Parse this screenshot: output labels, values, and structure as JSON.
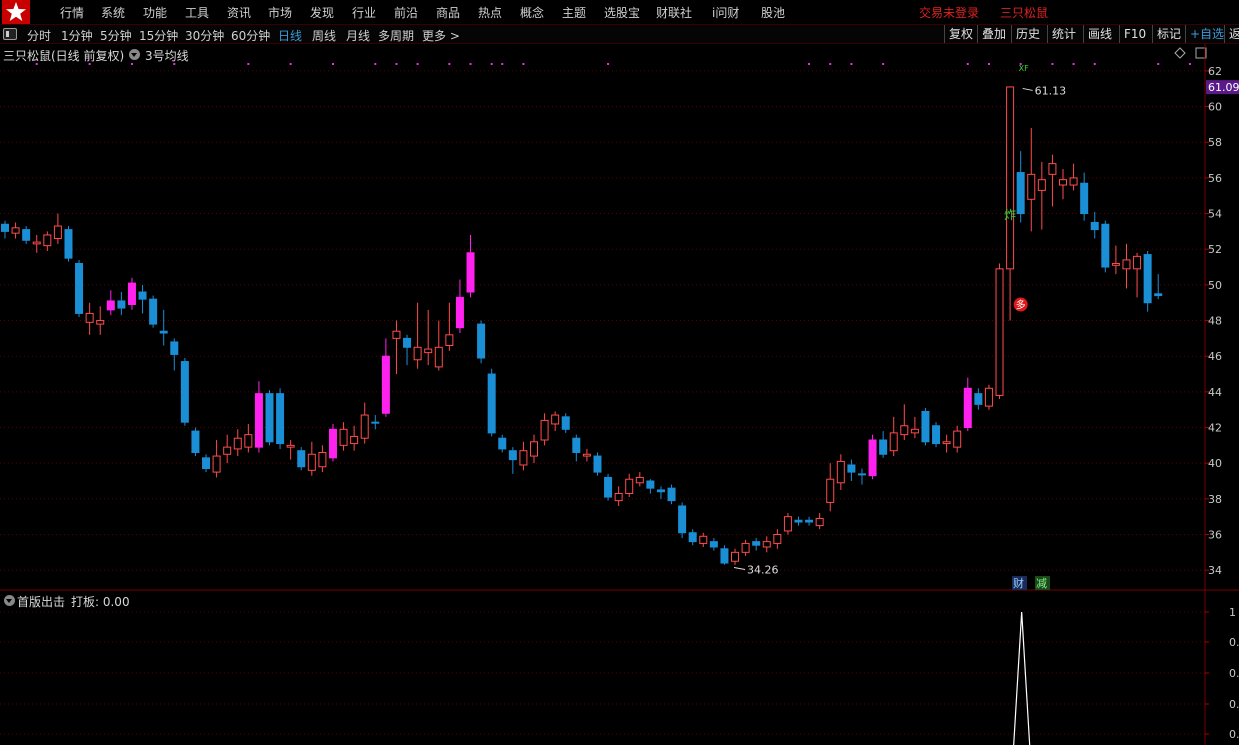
{
  "menu": {
    "items": [
      "行情",
      "系统",
      "功能",
      "工具",
      "资讯",
      "市场",
      "发现",
      "行业",
      "前沿",
      "商品",
      "热点",
      "概念",
      "主题",
      "选股宝",
      "财联社",
      "i问财",
      "股池"
    ],
    "login_status": "交易未登录",
    "stock_name": "三只松鼠"
  },
  "toolbar": {
    "periods": [
      "分时",
      "1分钟",
      "5分钟",
      "15分钟",
      "30分钟",
      "60分钟",
      "日线",
      "周线",
      "月线",
      "多周期",
      "更多 >"
    ],
    "active_period": "日线",
    "right_buttons": [
      "复权",
      "叠加",
      "历史",
      "统计",
      "画线",
      "F10",
      "标记",
      "+自选",
      "返"
    ]
  },
  "chart_header": {
    "title": "三只松鼠(日线 前复权)",
    "ma_label": "3号均线"
  },
  "indicator": {
    "name": "首版出击",
    "value_label": "打板: 0.00"
  },
  "colors": {
    "up": "#ff4c4c",
    "down": "#1a8fd6",
    "special": "#ff22ee",
    "grid": "#5a0000",
    "axis_text": "#c8c8c8",
    "price_tag_bg": "#5a1a8a"
  },
  "chart_data": {
    "type": "candlestick",
    "ylim": [
      33,
      62.5
    ],
    "y_ticks": [
      34,
      36,
      38,
      40,
      42,
      44,
      46,
      48,
      50,
      52,
      54,
      56,
      58,
      60,
      62
    ],
    "current_price": "61.09",
    "annotations": {
      "high": "61.13",
      "low": "34.26"
    },
    "signal_labels": {
      "zha": "炸",
      "duo": "多",
      "cai": "财",
      "jian": "减",
      "top": "XF"
    },
    "candles": [
      {
        "o": 53.0,
        "c": 53.4,
        "h": 53.6,
        "l": 52.6,
        "k": "d"
      },
      {
        "o": 52.9,
        "c": 53.2,
        "h": 53.5,
        "l": 52.6,
        "k": "u"
      },
      {
        "o": 53.1,
        "c": 52.5,
        "h": 53.3,
        "l": 52.3,
        "k": "d"
      },
      {
        "o": 52.3,
        "c": 52.4,
        "h": 52.8,
        "l": 51.8,
        "k": "u"
      },
      {
        "o": 52.2,
        "c": 52.8,
        "h": 53.0,
        "l": 51.9,
        "k": "u"
      },
      {
        "o": 52.6,
        "c": 53.3,
        "h": 54.0,
        "l": 52.3,
        "k": "u"
      },
      {
        "o": 53.1,
        "c": 51.5,
        "h": 53.3,
        "l": 51.3,
        "k": "d"
      },
      {
        "o": 51.2,
        "c": 48.4,
        "h": 51.4,
        "l": 48.2,
        "k": "d"
      },
      {
        "o": 47.9,
        "c": 48.4,
        "h": 49.0,
        "l": 47.2,
        "k": "u"
      },
      {
        "o": 48.0,
        "c": 47.8,
        "h": 48.8,
        "l": 47.2,
        "k": "u"
      },
      {
        "o": 48.6,
        "c": 49.1,
        "h": 49.7,
        "l": 48.3,
        "k": "s"
      },
      {
        "o": 49.1,
        "c": 48.7,
        "h": 49.6,
        "l": 48.3,
        "k": "d"
      },
      {
        "o": 48.9,
        "c": 50.1,
        "h": 50.4,
        "l": 48.6,
        "k": "s"
      },
      {
        "o": 49.6,
        "c": 49.2,
        "h": 50.0,
        "l": 48.4,
        "k": "d"
      },
      {
        "o": 49.2,
        "c": 47.8,
        "h": 49.4,
        "l": 47.6,
        "k": "d"
      },
      {
        "o": 47.4,
        "c": 47.3,
        "h": 48.6,
        "l": 46.6,
        "k": "d"
      },
      {
        "o": 46.8,
        "c": 46.1,
        "h": 47.0,
        "l": 45.2,
        "k": "d"
      },
      {
        "o": 45.7,
        "c": 42.3,
        "h": 45.9,
        "l": 42.1,
        "k": "d"
      },
      {
        "o": 41.8,
        "c": 40.6,
        "h": 42.0,
        "l": 40.4,
        "k": "d"
      },
      {
        "o": 40.3,
        "c": 39.7,
        "h": 40.5,
        "l": 39.5,
        "k": "d"
      },
      {
        "o": 39.5,
        "c": 40.4,
        "h": 41.3,
        "l": 39.2,
        "k": "u"
      },
      {
        "o": 40.5,
        "c": 40.9,
        "h": 41.6,
        "l": 40.0,
        "k": "u"
      },
      {
        "o": 40.8,
        "c": 41.4,
        "h": 41.9,
        "l": 40.4,
        "k": "u"
      },
      {
        "o": 40.9,
        "c": 41.6,
        "h": 42.2,
        "l": 40.6,
        "k": "u"
      },
      {
        "o": 40.9,
        "c": 43.9,
        "h": 44.6,
        "l": 40.6,
        "k": "s"
      },
      {
        "o": 43.9,
        "c": 41.2,
        "h": 44.1,
        "l": 41.0,
        "k": "d"
      },
      {
        "o": 43.9,
        "c": 41.1,
        "h": 44.2,
        "l": 40.8,
        "k": "d"
      },
      {
        "o": 40.9,
        "c": 41.0,
        "h": 41.3,
        "l": 40.2,
        "k": "u"
      },
      {
        "o": 40.7,
        "c": 39.8,
        "h": 40.9,
        "l": 39.6,
        "k": "d"
      },
      {
        "o": 39.6,
        "c": 40.5,
        "h": 41.2,
        "l": 39.3,
        "k": "u"
      },
      {
        "o": 39.8,
        "c": 40.6,
        "h": 41.0,
        "l": 39.5,
        "k": "u"
      },
      {
        "o": 40.3,
        "c": 41.9,
        "h": 42.2,
        "l": 40.1,
        "k": "s"
      },
      {
        "o": 41.0,
        "c": 41.9,
        "h": 42.3,
        "l": 40.7,
        "k": "u"
      },
      {
        "o": 41.5,
        "c": 41.1,
        "h": 42.1,
        "l": 40.7,
        "k": "u"
      },
      {
        "o": 41.4,
        "c": 42.7,
        "h": 43.4,
        "l": 41.1,
        "k": "u"
      },
      {
        "o": 42.3,
        "c": 42.3,
        "h": 42.7,
        "l": 41.9,
        "k": "d"
      },
      {
        "o": 42.8,
        "c": 46.0,
        "h": 47.0,
        "l": 42.6,
        "k": "s"
      },
      {
        "o": 47.0,
        "c": 47.4,
        "h": 48.0,
        "l": 45.0,
        "k": "u"
      },
      {
        "o": 47.0,
        "c": 46.5,
        "h": 47.2,
        "l": 45.5,
        "k": "d"
      },
      {
        "o": 45.8,
        "c": 46.5,
        "h": 49.0,
        "l": 45.3,
        "k": "u"
      },
      {
        "o": 46.2,
        "c": 46.4,
        "h": 48.6,
        "l": 45.5,
        "k": "u"
      },
      {
        "o": 45.4,
        "c": 46.5,
        "h": 48.0,
        "l": 45.2,
        "k": "u"
      },
      {
        "o": 46.6,
        "c": 47.2,
        "h": 49.0,
        "l": 46.3,
        "k": "u"
      },
      {
        "o": 47.6,
        "c": 49.3,
        "h": 50.3,
        "l": 47.3,
        "k": "s"
      },
      {
        "o": 49.6,
        "c": 51.8,
        "h": 52.8,
        "l": 49.3,
        "k": "s"
      },
      {
        "o": 47.8,
        "c": 45.9,
        "h": 48.0,
        "l": 45.6,
        "k": "d"
      },
      {
        "o": 45.0,
        "c": 41.7,
        "h": 45.3,
        "l": 41.5,
        "k": "d"
      },
      {
        "o": 41.4,
        "c": 40.8,
        "h": 41.6,
        "l": 40.6,
        "k": "d"
      },
      {
        "o": 40.7,
        "c": 40.2,
        "h": 40.9,
        "l": 39.4,
        "k": "d"
      },
      {
        "o": 39.9,
        "c": 40.7,
        "h": 41.2,
        "l": 39.6,
        "k": "u"
      },
      {
        "o": 40.4,
        "c": 41.2,
        "h": 41.6,
        "l": 40.0,
        "k": "u"
      },
      {
        "o": 41.3,
        "c": 42.4,
        "h": 42.8,
        "l": 41.0,
        "k": "u"
      },
      {
        "o": 42.2,
        "c": 42.7,
        "h": 42.9,
        "l": 41.8,
        "k": "u"
      },
      {
        "o": 42.6,
        "c": 41.9,
        "h": 42.8,
        "l": 41.7,
        "k": "d"
      },
      {
        "o": 41.4,
        "c": 40.6,
        "h": 41.6,
        "l": 40.1,
        "k": "d"
      },
      {
        "o": 40.4,
        "c": 40.5,
        "h": 40.8,
        "l": 40.1,
        "k": "u"
      },
      {
        "o": 40.4,
        "c": 39.5,
        "h": 40.6,
        "l": 39.3,
        "k": "d"
      },
      {
        "o": 39.2,
        "c": 38.1,
        "h": 39.4,
        "l": 37.9,
        "k": "d"
      },
      {
        "o": 37.9,
        "c": 38.3,
        "h": 38.7,
        "l": 37.6,
        "k": "u"
      },
      {
        "o": 38.3,
        "c": 39.1,
        "h": 39.4,
        "l": 38.1,
        "k": "u"
      },
      {
        "o": 38.9,
        "c": 39.2,
        "h": 39.5,
        "l": 38.7,
        "k": "u"
      },
      {
        "o": 39.0,
        "c": 38.6,
        "h": 39.1,
        "l": 38.3,
        "k": "d"
      },
      {
        "o": 38.5,
        "c": 38.4,
        "h": 38.7,
        "l": 38.0,
        "k": "d"
      },
      {
        "o": 38.6,
        "c": 37.9,
        "h": 38.8,
        "l": 37.7,
        "k": "d"
      },
      {
        "o": 37.6,
        "c": 36.1,
        "h": 37.8,
        "l": 35.8,
        "k": "d"
      },
      {
        "o": 36.1,
        "c": 35.6,
        "h": 36.3,
        "l": 35.4,
        "k": "d"
      },
      {
        "o": 35.5,
        "c": 35.9,
        "h": 36.1,
        "l": 35.3,
        "k": "u"
      },
      {
        "o": 35.6,
        "c": 35.3,
        "h": 35.8,
        "l": 35.1,
        "k": "d"
      },
      {
        "o": 35.2,
        "c": 34.4,
        "h": 35.4,
        "l": 34.3,
        "k": "d"
      },
      {
        "o": 34.5,
        "c": 35.0,
        "h": 35.2,
        "l": 34.3,
        "k": "u"
      },
      {
        "o": 35.0,
        "c": 35.5,
        "h": 35.7,
        "l": 34.8,
        "k": "u"
      },
      {
        "o": 35.6,
        "c": 35.4,
        "h": 35.8,
        "l": 35.1,
        "k": "d"
      },
      {
        "o": 35.3,
        "c": 35.6,
        "h": 35.9,
        "l": 35.0,
        "k": "u"
      },
      {
        "o": 35.5,
        "c": 36.0,
        "h": 36.3,
        "l": 35.2,
        "k": "u"
      },
      {
        "o": 36.2,
        "c": 37.0,
        "h": 37.2,
        "l": 36.0,
        "k": "u"
      },
      {
        "o": 36.8,
        "c": 36.7,
        "h": 37.0,
        "l": 36.5,
        "k": "d"
      },
      {
        "o": 36.7,
        "c": 36.8,
        "h": 37.0,
        "l": 36.5,
        "k": "d"
      },
      {
        "o": 36.5,
        "c": 36.9,
        "h": 37.2,
        "l": 36.3,
        "k": "u"
      },
      {
        "o": 37.8,
        "c": 39.1,
        "h": 40.0,
        "l": 37.3,
        "k": "u"
      },
      {
        "o": 38.9,
        "c": 40.1,
        "h": 40.5,
        "l": 38.5,
        "k": "u"
      },
      {
        "o": 39.9,
        "c": 39.5,
        "h": 40.2,
        "l": 39.0,
        "k": "d"
      },
      {
        "o": 39.4,
        "c": 39.4,
        "h": 39.7,
        "l": 38.8,
        "k": "d"
      },
      {
        "o": 39.3,
        "c": 41.3,
        "h": 41.6,
        "l": 39.1,
        "k": "s"
      },
      {
        "o": 41.3,
        "c": 40.5,
        "h": 41.8,
        "l": 40.3,
        "k": "d"
      },
      {
        "o": 40.7,
        "c": 41.7,
        "h": 42.6,
        "l": 40.4,
        "k": "u"
      },
      {
        "o": 41.6,
        "c": 42.1,
        "h": 43.3,
        "l": 41.3,
        "k": "u"
      },
      {
        "o": 41.9,
        "c": 41.7,
        "h": 42.6,
        "l": 41.4,
        "k": "u"
      },
      {
        "o": 42.9,
        "c": 41.2,
        "h": 43.1,
        "l": 41.0,
        "k": "d"
      },
      {
        "o": 42.1,
        "c": 41.1,
        "h": 42.3,
        "l": 40.9,
        "k": "d"
      },
      {
        "o": 41.1,
        "c": 41.2,
        "h": 41.6,
        "l": 40.6,
        "k": "u"
      },
      {
        "o": 40.9,
        "c": 41.8,
        "h": 42.1,
        "l": 40.6,
        "k": "u"
      },
      {
        "o": 42.0,
        "c": 44.2,
        "h": 44.8,
        "l": 41.8,
        "k": "s"
      },
      {
        "o": 43.9,
        "c": 43.3,
        "h": 44.2,
        "l": 43.0,
        "k": "d"
      },
      {
        "o": 43.2,
        "c": 44.2,
        "h": 44.4,
        "l": 43.0,
        "k": "u"
      },
      {
        "o": 43.8,
        "c": 50.9,
        "h": 51.2,
        "l": 43.6,
        "k": "u"
      },
      {
        "o": 50.9,
        "c": 61.1,
        "h": 61.13,
        "l": 48.0,
        "k": "u"
      },
      {
        "o": 56.3,
        "c": 54.0,
        "h": 57.5,
        "l": 53.5,
        "k": "d"
      },
      {
        "o": 54.8,
        "c": 56.2,
        "h": 58.8,
        "l": 53.0,
        "k": "u"
      },
      {
        "o": 55.3,
        "c": 55.9,
        "h": 56.9,
        "l": 53.1,
        "k": "u"
      },
      {
        "o": 56.2,
        "c": 56.8,
        "h": 57.3,
        "l": 54.4,
        "k": "u"
      },
      {
        "o": 55.9,
        "c": 55.6,
        "h": 56.5,
        "l": 54.8,
        "k": "u"
      },
      {
        "o": 55.6,
        "c": 56.0,
        "h": 56.8,
        "l": 55.3,
        "k": "u"
      },
      {
        "o": 55.7,
        "c": 54.0,
        "h": 56.3,
        "l": 53.6,
        "k": "d"
      },
      {
        "o": 53.5,
        "c": 53.1,
        "h": 54.1,
        "l": 52.6,
        "k": "d"
      },
      {
        "o": 53.4,
        "c": 51.0,
        "h": 53.6,
        "l": 50.7,
        "k": "d"
      },
      {
        "o": 51.1,
        "c": 51.2,
        "h": 52.2,
        "l": 50.6,
        "k": "u"
      },
      {
        "o": 50.9,
        "c": 51.4,
        "h": 52.3,
        "l": 49.8,
        "k": "u"
      },
      {
        "o": 51.6,
        "c": 50.9,
        "h": 51.8,
        "l": 49.3,
        "k": "u"
      },
      {
        "o": 51.7,
        "c": 49.0,
        "h": 51.9,
        "l": 48.5,
        "k": "d"
      },
      {
        "o": 49.4,
        "c": 49.5,
        "h": 50.6,
        "l": 49.2,
        "k": "d"
      }
    ],
    "top_dot_columns": [
      3,
      8,
      12,
      16,
      23,
      27,
      31,
      35,
      37,
      39,
      42,
      44,
      46,
      47,
      49,
      57,
      76,
      78,
      80,
      83,
      91,
      93,
      96,
      99,
      101,
      103,
      109,
      112
    ],
    "indicator_peak": {
      "candle_index": 96,
      "value": 1
    },
    "indicator_ticks": [
      "1",
      "0.",
      "0.",
      "0.",
      "0.",
      "0."
    ]
  }
}
